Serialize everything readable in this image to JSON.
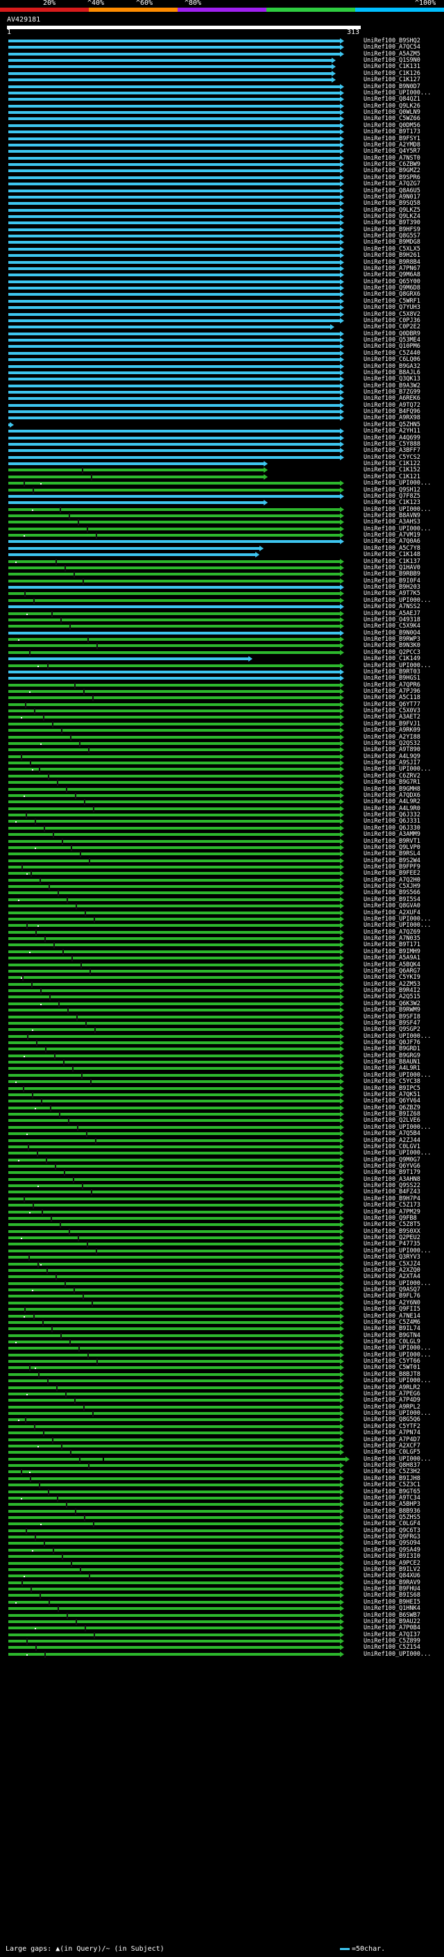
{
  "scale": {
    "labels": [
      "20%",
      "^40%",
      "^60%",
      "^80%",
      "^100%"
    ],
    "colors": [
      "#d81b1b",
      "#ff8c00",
      "#a020f0",
      "#2ecc40",
      "#00bfff"
    ]
  },
  "query": {
    "name": "AV429181",
    "start": "1",
    "end": "313"
  },
  "colors": {
    "high": "#3ec6f0",
    "mid": "#2db82d",
    "background": "#000000",
    "query": "#ffffff"
  },
  "hits": [
    "UniRef100_B9SHQ2",
    "UniRef100_A7QC54",
    "UniRef100_A5AZM5",
    "UniRef100_Q1S9N0",
    "UniRef100_C1K131",
    "UniRef100_C1K126",
    "UniRef100_C1K127",
    "UniRef100_B9N0D7",
    "UniRef100_UPI000...",
    "UniRef100_Q84QZ1",
    "UniRef100_Q9LK26",
    "UniRef100_Q0WLN9",
    "UniRef100_C5WZ66",
    "UniRef100_Q0DM56",
    "UniRef100_B9T173",
    "UniRef100_B9FSY1",
    "UniRef100_A2YMD8",
    "UniRef100_Q4Y5R7",
    "UniRef100_A7NST0",
    "UniRef100_C6ZBW9",
    "UniRef100_B9GMZ2",
    "UniRef100_B9SPR6",
    "UniRef100_A7QZG7",
    "UniRef100_Q8A6U5",
    "UniRef100_A9N017",
    "UniRef100_B9SQ58",
    "UniRef100_Q9LKZ5",
    "UniRef100_Q9LKZ4",
    "UniRef100_B9T390",
    "UniRef100_B9HFS9",
    "UniRef100_Q8G5S7",
    "UniRef100_B9MDG8",
    "UniRef100_C5XLX5",
    "UniRef100_B9H261",
    "UniRef100_B9R8B4",
    "UniRef100_A7PN67",
    "UniRef100_Q9M6A8",
    "UniRef100_Q65Y00",
    "UniRef100_Q9M6D8",
    "UniRef100_Q8GRX6",
    "UniRef100_C5WRF1",
    "UniRef100_Q7YUH3",
    "UniRef100_C5X8V2",
    "UniRef100_C0PJ36",
    "UniRef100_C0P2E2",
    "UniRef100_Q0DBR9",
    "UniRef100_Q53ME4",
    "UniRef100_Q10PM6",
    "UniRef100_C5Z440",
    "UniRef100_C6LQ06",
    "UniRef100_B9GA32",
    "UniRef100_B8AJL6",
    "UniRef100_Q3QK13",
    "UniRef100_B9A3W2",
    "UniRef100_B7ZG99",
    "UniRef100_A6REK6",
    "UniRef100_A9TQ72",
    "UniRef100_B4FQ96",
    "UniRef100_A9RX98",
    "UniRef100_Q5ZHN5",
    "UniRef100_A2YH11",
    "UniRef100_A4Q699",
    "UniRef100_C5Y888",
    "UniRef100_A3BFF7",
    "UniRef100_C5YCS2",
    "UniRef100_C1K122",
    "UniRef100_C1K152",
    "UniRef100_C1K121",
    "UniRef100_UPI000...",
    "UniRef100_Q9SH12",
    "UniRef100_Q7F8Z5",
    "UniRef100_C1K123",
    "UniRef100_UPI000...",
    "UniRef100_B8AVN9",
    "UniRef100_A3AHS3",
    "UniRef100_UPI000...",
    "UniRef100_A7VM19",
    "UniRef100_A7Q0A6",
    "UniRef100_A5C7Y8",
    "UniRef100_C1K148",
    "UniRef100_C1K137",
    "UniRef100_Q1HAV0",
    "UniRef100_B9RBB9",
    "UniRef100_B9I0F4",
    "UniRef100_B9H203",
    "UniRef100_A9T7K5",
    "UniRef100_UPI000...",
    "UniRef100_A7NSS2",
    "UniRef100_A5AEJ7",
    "UniRef100_O49318",
    "UniRef100_C5X9K4",
    "UniRef100_B9N0O4",
    "UniRef100_B9RWP3",
    "UniRef100_B9N3K0",
    "UniRef100_Q2PCC3",
    "UniRef100_C1K149",
    "UniRef100_UPI000...",
    "UniRef100_B9RT03",
    "UniRef100_B9HGS1",
    "UniRef100_A7QPR6",
    "UniRef100_A7PJ96",
    "UniRef100_A5C118",
    "UniRef100_Q6YT77",
    "UniRef100_C5X0V3",
    "UniRef100_A3AET2",
    "UniRef100_B9FVJ1",
    "UniRef100_A9RK09",
    "UniRef100_A2YI88",
    "UniRef100_Q2QS32",
    "UniRef100_A9T890",
    "UniRef100_A4L9Q9",
    "UniRef100_A9SJI7",
    "UniRef100_UPI000...",
    "UniRef100_C6ZRV2",
    "UniRef100_B9G7R1",
    "UniRef100_B9GMH8",
    "UniRef100_A7QDX6",
    "UniRef100_A4L9R2",
    "UniRef100_A4L9R0",
    "UniRef100_Q6J332",
    "UniRef100_Q6J331",
    "UniRef100_Q6J330",
    "UniRef100_A3AMM9",
    "UniRef100_B9RVT1",
    "UniRef100_Q9LVP0",
    "UniRef100_B9RSL4",
    "UniRef100_B9S2W4",
    "UniRef100_B9FPF9",
    "UniRef100_B9FEE2",
    "UniRef100_A7Q2H0",
    "UniRef100_C5XJH9",
    "UniRef100_B9S566",
    "UniRef100_B9I5S4",
    "UniRef100_Q8GVA0",
    "UniRef100_A2XUF4",
    "UniRef100_UPI000...",
    "UniRef100_UPI000...",
    "UniRef100_A7QZ69",
    "UniRef100_A7N035",
    "UniRef100_B9T171",
    "UniRef100_B9IMH9",
    "UniRef100_A5A9A1",
    "UniRef100_A5BQK4",
    "UniRef100_Q6ARG7",
    "UniRef100_C5YKI9",
    "UniRef100_A2ZM53",
    "UniRef100_B9R4I2",
    "UniRef100_A2Q515",
    "UniRef100_Q6K3W2",
    "UniRef100_B9RWM9",
    "UniRef100_B9SFI8",
    "UniRef100_B9SF47",
    "UniRef100_Q9SGP2",
    "UniRef100_UPI000...",
    "UniRef100_Q0JF76",
    "UniRef100_B9GRD1",
    "UniRef100_B9GRG9",
    "UniRef100_B8AUN1",
    "UniRef100_A4L9R1",
    "UniRef100_UPI000...",
    "UniRef100_C5YC38",
    "UniRef100_B9IPC5",
    "UniRef100_A7QK51",
    "UniRef100_Q6YV64",
    "UniRef100_Q6ZBZ9",
    "UniRef100_B9IZ68",
    "UniRef100_Q2LVE6",
    "UniRef100_UPI000...",
    "UniRef100_A7Q5B4",
    "UniRef100_A2ZJ44",
    "UniRef100_C0LGV1",
    "UniRef100_UPI000...",
    "UniRef100_Q9M0G7",
    "UniRef100_Q6YVG6",
    "UniRef100_B9T179",
    "UniRef100_A3AHN8",
    "UniRef100_Q9SS22",
    "UniRef100_B4FZ43",
    "UniRef100_B9H7P4",
    "UniRef100_C5Z173",
    "UniRef100_A7PM29",
    "UniRef100_Q9FB8",
    "UniRef100_C5Z8T5",
    "UniRef100_B9S0XX",
    "UniRef100_Q2PEU2",
    "UniRef100_P47735",
    "UniRef100_UPI000...",
    "UniRef100_Q3RYV3",
    "UniRef100_C5XJZ4",
    "UniRef100_A2XZQ0",
    "UniRef100_A2XTA4",
    "UniRef100_UPI000...",
    "UniRef100_Q9ASQ7",
    "UniRef100_B9FL76",
    "UniRef100_A2Y6N0",
    "UniRef100_Q9FII5",
    "UniRef100_A7NE14",
    "UniRef100_C5Z4M6",
    "UniRef100_B9IL74",
    "UniRef100_B9GTN4",
    "UniRef100_C0LGL9",
    "UniRef100_UPI000...",
    "UniRef100_UPI000...",
    "UniRef100_C5YT66",
    "UniRef100_C5WT01",
    "UniRef100_B8BJT8",
    "UniRef100_UPI000...",
    "UniRef100_A9RLR2",
    "UniRef100_A7PEG6",
    "UniRef100_A7P4D9",
    "UniRef100_A9RPL2",
    "UniRef100_UPI000...",
    "UniRef100_Q8G5Q6",
    "UniRef100_C5YTF2",
    "UniRef100_A7PN74",
    "UniRef100_A7P4D7",
    "UniRef100_A2XCF7",
    "UniRef100_C0LGF5",
    "UniRef100_UPI000...",
    "UniRef100_Q8H837",
    "UniRef100_C5Z3H2",
    "UniRef100_B9IJH8",
    "UniRef100_C5Z3C1",
    "UniRef100_B9GT65",
    "UniRef100_A9TC34",
    "UniRef100_A5BHP3",
    "UniRef100_B8B936",
    "UniRef100_Q5ZHS5",
    "UniRef100_C0LGF4",
    "UniRef100_Q9C6T3",
    "UniRef100_Q9FRG3",
    "UniRef100_Q9SO94",
    "UniRef100_Q9SA49",
    "UniRef100_B9I3I0",
    "UniRef100_A9PCE2",
    "UniRef100_B9ILV2",
    "UniRef100_Q84XU6",
    "UniRef100_B9RAV9",
    "UniRef100_B9FHU4",
    "UniRef100_B9IS68",
    "UniRef100_B9HEI5",
    "UniRef100_Q1HNK4",
    "UniRef100_B6SWB7",
    "UniRef100_B9AU22",
    "UniRef100_A7P0B4",
    "UniRef100_A7QI37",
    "UniRef100_C5Z899",
    "UniRef100_C5Z154",
    "UniRef100_UPI000..."
  ],
  "legend": {
    "left": "Large gaps: ▲(in Query)/~ (in Subject)",
    "right": "=50char."
  }
}
